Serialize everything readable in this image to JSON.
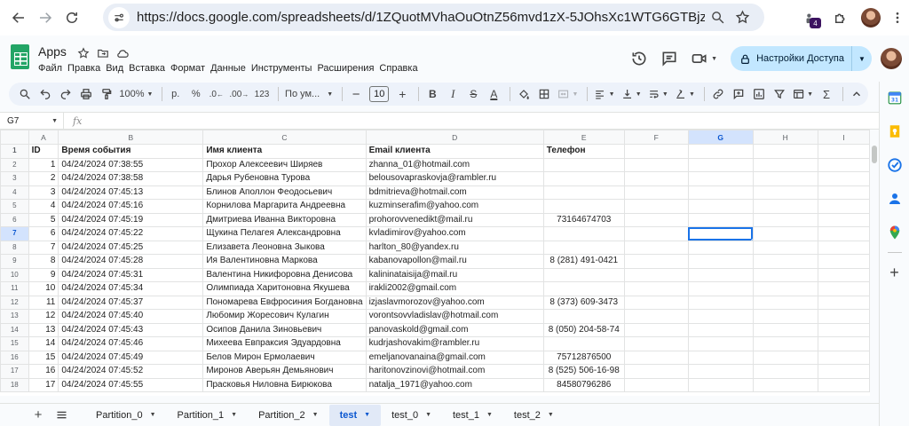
{
  "browser": {
    "url": "https://docs.google.com/spreadsheets/d/1ZQuotMVhaOuOtnZ56mvd1zX-5JOhsXc1WTG6GTBjzzM/edit#...",
    "ext_badge": "4"
  },
  "app": {
    "title": "Apps",
    "menu": [
      "Файл",
      "Правка",
      "Вид",
      "Вставка",
      "Формат",
      "Данные",
      "Инструменты",
      "Расширения",
      "Справка"
    ],
    "share_label": "Настройки Доступа"
  },
  "toolbar": {
    "zoom": "100%",
    "currency": "р.",
    "percent": "%",
    "decrease_decimals": ".0",
    "increase_decimals": ".00",
    "number_format": "123",
    "font": "По ум...",
    "font_size": "10"
  },
  "formula": {
    "cell_ref": "G7",
    "fx": "fx"
  },
  "grid": {
    "columns": [
      "A",
      "B",
      "C",
      "D",
      "E",
      "F",
      "G",
      "H",
      "I"
    ],
    "selected_column": "G",
    "selected_row": 7,
    "header": [
      "ID",
      "Время события",
      "Имя клиента",
      "Email клиента",
      "Телефон",
      "",
      "",
      "",
      ""
    ],
    "rows": [
      [
        "1",
        "04/24/2024 07:38:55",
        "Прохор Алексеевич Ширяев",
        "zhanna_01@hotmail.com",
        ""
      ],
      [
        "2",
        "04/24/2024 07:38:58",
        "Дарья Рубеновна Турова",
        "belousovapraskovja@rambler.ru",
        ""
      ],
      [
        "3",
        "04/24/2024 07:45:13",
        "Блинов Аполлон Феодосьевич",
        "bdmitrieva@hotmail.com",
        ""
      ],
      [
        "4",
        "04/24/2024 07:45:16",
        "Корнилова Маргарита Андреевна",
        "kuzminserafim@yahoo.com",
        ""
      ],
      [
        "5",
        "04/24/2024 07:45:19",
        "Дмитриева Иванна Викторовна",
        "prohorovvenedikt@mail.ru",
        "73164674703"
      ],
      [
        "6",
        "04/24/2024 07:45:22",
        "Щукина Пелагея Александровна",
        "kvladimirov@yahoo.com",
        ""
      ],
      [
        "7",
        "04/24/2024 07:45:25",
        "Елизавета Леоновна Зыкова",
        "harlton_80@yandex.ru",
        ""
      ],
      [
        "8",
        "04/24/2024 07:45:28",
        "Ия Валентиновна Маркова",
        "kabanovapollon@mail.ru",
        "8 (281) 491-0421"
      ],
      [
        "9",
        "04/24/2024 07:45:31",
        "Валентина Никифоровна Денисова",
        "kalininataisija@mail.ru",
        ""
      ],
      [
        "10",
        "04/24/2024 07:45:34",
        "Олимпиада Харитоновна Якушева",
        "irakli2002@gmail.com",
        ""
      ],
      [
        "11",
        "04/24/2024 07:45:37",
        "Пономарева Евфросиния Богдановна",
        "izjaslavmorozov@yahoo.com",
        "8 (373) 609-3473"
      ],
      [
        "12",
        "04/24/2024 07:45:40",
        "Любомир Жоресович Кулагин",
        "vorontsovvladislav@hotmail.com",
        ""
      ],
      [
        "13",
        "04/24/2024 07:45:43",
        "Осипов Данила Зиновьевич",
        "panovaskold@gmail.com",
        "8 (050) 204-58-74"
      ],
      [
        "14",
        "04/24/2024 07:45:46",
        "Михеева Евпраксия Эдуардовна",
        "kudrjashovakim@rambler.ru",
        ""
      ],
      [
        "15",
        "04/24/2024 07:45:49",
        "Белов Мирон Ермолаевич",
        "emeljanovanaina@gmail.com",
        "75712876500"
      ],
      [
        "16",
        "04/24/2024 07:45:52",
        "Миронов Аверьян Демьянович",
        "haritonovzinovi@hotmail.com",
        "8 (525) 506-16-98"
      ],
      [
        "17",
        "04/24/2024 07:45:55",
        "Прасковья Ниловна Бирюкова",
        "natalja_1971@yahoo.com",
        "84580796286"
      ]
    ]
  },
  "sheets": {
    "tabs": [
      "Partition_0",
      "Partition_1",
      "Partition_2",
      "test",
      "test_0",
      "test_1",
      "test_2"
    ],
    "active": "test"
  },
  "colors": {
    "sheets_green": "#23a566",
    "share_bg": "#c2e7ff",
    "selection_blue": "#1a73e8",
    "active_tab_bg": "#e1e9f7"
  }
}
